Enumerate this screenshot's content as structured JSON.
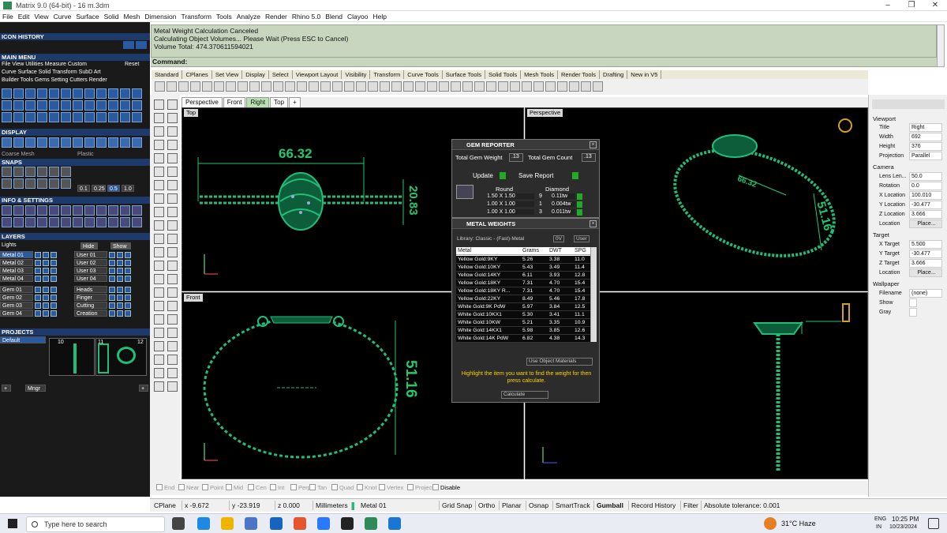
{
  "window": {
    "title": "Matrix 9.0 (64-bit) - 16 m.3dm",
    "min": "–",
    "max": "❐",
    "close": "✕"
  },
  "menu": [
    "File",
    "Edit",
    "View",
    "Curve",
    "Surface",
    "Solid",
    "Mesh",
    "Dimension",
    "Transform",
    "Tools",
    "Analyze",
    "Render",
    "Rhino 5.0",
    "Blend",
    "Clayoo",
    "Help"
  ],
  "left": {
    "icon_history": "ICON HISTORY",
    "main_menu": "MAIN MENU",
    "main_menu_row1": "File  View  Utilities  Measure  Custom",
    "reset": "Reset",
    "main_menu_row2": "Curve Surface Solid Transform SubD Art",
    "main_menu_row3": "Builder Tools Gems Setting Cutters Render",
    "display": "DISPLAY",
    "coarse_mesh": "Coarse Mesh",
    "plastic": "Plastic",
    "snaps": "SNAPS",
    "snap_vals": [
      "0.1",
      "0.25",
      "0.5",
      "1.0"
    ],
    "info": "INFO & SETTINGS",
    "layers": "LAYERS",
    "lights": "Lights",
    "hide": "Hide",
    "show": "Show",
    "metal_layers": [
      "Metal 01",
      "Metal 02",
      "Metal 03",
      "Metal 04"
    ],
    "user_layers": [
      "User 01",
      "User 02",
      "User 03",
      "User 04"
    ],
    "gem_layers": [
      "Gem 01",
      "Gem 02",
      "Gem 03",
      "Gem 04"
    ],
    "other_layers": [
      "Heads",
      "Finger",
      "Cutting",
      "Creation"
    ],
    "projects": "PROJECTS",
    "default": "Default",
    "thumbs": [
      "10",
      "11",
      "12"
    ],
    "mngr": "Mngr",
    "plus": "+"
  },
  "command": {
    "line1": "Metal Weight Calculation Canceled",
    "line2": "Calculating Object Volumes... Please Wait (Press ESC to Cancel)",
    "line3": "Volume Total: 474.370611594021",
    "label": "Command:"
  },
  "tabs": [
    "Standard",
    "CPlanes",
    "Set View",
    "Display",
    "Select",
    "Viewport Layout",
    "Visibility",
    "Transform",
    "Curve Tools",
    "Surface Tools",
    "Solid Tools",
    "Mesh Tools",
    "Render Tools",
    "Drafting",
    "New in V5"
  ],
  "viewtabs": [
    "Perspective",
    "Front",
    "Right",
    "Top",
    "+"
  ],
  "viewports": {
    "top": "Top",
    "perspective": "Perspective",
    "front": "Front"
  },
  "dims": {
    "top_w": "66.32",
    "top_h": "20.83",
    "persp_a": "66.32",
    "persp_b": "51.16",
    "front_h": "51.16"
  },
  "gem": {
    "title": "GEM REPORTER",
    "total_weight": "Total Gem Weight",
    "weight_val": ".13",
    "total_count": "Total Gem Count",
    "count_val": ".13",
    "update": "Update",
    "save": "Save Report",
    "col_round": "Round",
    "col_diamond": "Diamond",
    "rows": [
      [
        "1.50 X 1.50",
        "9",
        "0.11tw"
      ],
      [
        "1.00 X 1.00",
        "1",
        "0.004tw"
      ],
      [
        "1.00 X 1.00",
        "3",
        "0.011tw"
      ]
    ]
  },
  "metal": {
    "title": "METAL WEIGHTS",
    "library": "Library: Classic - (Fast)-Metal",
    "ov": "0V",
    "user": "User",
    "headers": [
      "Metal",
      "Grams",
      "DWT",
      "SPG"
    ],
    "rows": [
      [
        "Yellow Gold:9KY",
        "5.26",
        "3.38",
        "11.0"
      ],
      [
        "Yellow Gold:10KY",
        "5.43",
        "3.49",
        "11.4"
      ],
      [
        "Yellow Gold:14KY",
        "6.11",
        "3.93",
        "12.8"
      ],
      [
        "Yellow Gold:18KY",
        "7.31",
        "4.70",
        "15.4"
      ],
      [
        "Yellow Gold:18KY R...",
        "7.31",
        "4.70",
        "15.4"
      ],
      [
        "Yellow Gold:22KY",
        "8.49",
        "5.46",
        "17.8"
      ],
      [
        "White Gold:9K PdW",
        "5.97",
        "3.84",
        "12.5"
      ],
      [
        "White Gold:10KX1",
        "5.30",
        "3.41",
        "11.1"
      ],
      [
        "White Gold:10KW",
        "5.21",
        "3.35",
        "10.9"
      ],
      [
        "White Gold:14KX1",
        "5.98",
        "3.85",
        "12.6"
      ],
      [
        "White Gold:14K PdW",
        "6.82",
        "4.38",
        "14.3"
      ]
    ],
    "use_obj": "Use Object Materials",
    "hint": "Highlight the item you want to find the weight for then press calculate.",
    "calc": "Calculate"
  },
  "props": {
    "viewport": "Viewport",
    "title_k": "Title",
    "title_v": "Right",
    "width_k": "Width",
    "width_v": "692",
    "height_k": "Height",
    "height_v": "376",
    "proj_k": "Projection",
    "proj_v": "Parallel",
    "camera": "Camera",
    "lens_k": "Lens Len...",
    "lens_v": "50.0",
    "rot_k": "Rotation",
    "rot_v": "0.0",
    "xl_k": "X Location",
    "xl_v": "100.010",
    "yl_k": "Y Location",
    "yl_v": "-30.477",
    "zl_k": "Z Location",
    "zl_v": "3.666",
    "loc_k": "Location",
    "place": "Place...",
    "target": "Target",
    "xt_k": "X Target",
    "xt_v": "5.500",
    "yt_k": "Y Target",
    "yt_v": "-30.477",
    "zt_k": "Z Target",
    "zt_v": "3.666",
    "loc2_k": "Location",
    "wallpaper": "Wallpaper",
    "fn_k": "Filename",
    "fn_v": "(none)",
    "show_k": "Show",
    "gray_k": "Gray"
  },
  "osnap": [
    {
      "t": "End",
      "on": false
    },
    {
      "t": "Near",
      "on": false
    },
    {
      "t": "Point",
      "on": false
    },
    {
      "t": "Mid",
      "on": false
    },
    {
      "t": "Cen",
      "on": false
    },
    {
      "t": "Int",
      "on": false
    },
    {
      "t": "Perp",
      "on": false
    },
    {
      "t": "Tan",
      "on": false
    },
    {
      "t": "Quad",
      "on": false
    },
    {
      "t": "Knot",
      "on": false
    },
    {
      "t": "Vertex",
      "on": false
    },
    {
      "t": "Project",
      "on": false
    },
    {
      "t": "Disable",
      "on": true
    }
  ],
  "status": {
    "cplane": "CPlane",
    "x": "x -9.672",
    "y": "y -23.919",
    "z": "z 0.000",
    "units": "Millimeters",
    "layer": "Metal 01",
    "gridsnap": "Grid Snap",
    "ortho": "Ortho",
    "planar": "Planar",
    "osnap": "Osnap",
    "smarttrack": "SmartTrack",
    "gumball": "Gumball",
    "history": "Record History",
    "filter": "Filter",
    "tol": "Absolute tolerance: 0.001"
  },
  "taskbar": {
    "search": "Type here to search",
    "weather": "31°C  Haze",
    "lang1": "ENG",
    "lang2": "IN",
    "time": "10:25 PM",
    "date": "10/23/2024"
  },
  "colors": {
    "model": "#1fbf7a",
    "dim": "#22c86e",
    "accent": "#2a5aa0"
  }
}
